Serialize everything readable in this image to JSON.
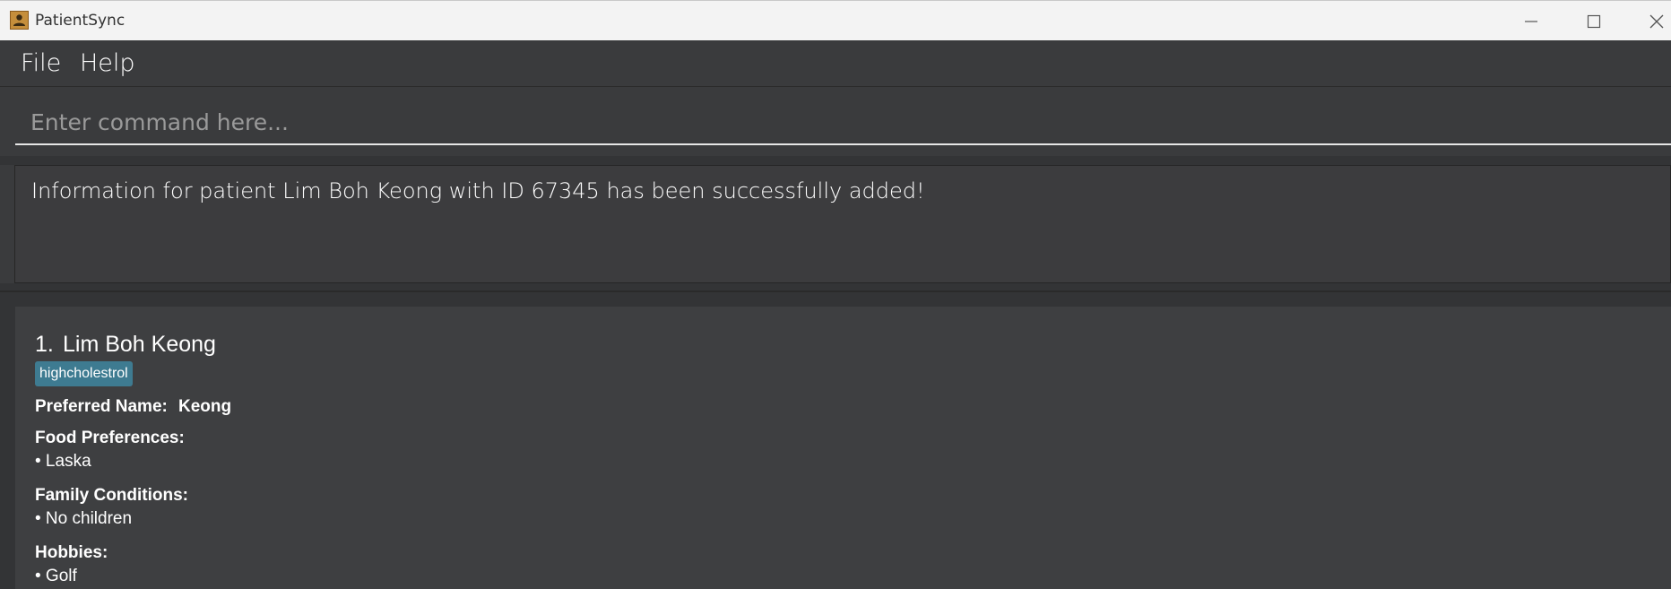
{
  "window": {
    "title": "PatientSync",
    "icon": "app-person-icon",
    "controls": [
      "minimize-icon",
      "maximize-icon",
      "close-icon"
    ]
  },
  "menu": {
    "items": [
      {
        "label": "File"
      },
      {
        "label": "Help"
      }
    ]
  },
  "command": {
    "value": "",
    "placeholder": "Enter command here..."
  },
  "result": {
    "message": "Information for patient Lim Boh Keong with ID 67345 has been successfully added!"
  },
  "patients": [
    {
      "index": "1.",
      "name": "Lim Boh Keong",
      "tags": [
        "highcholestrol"
      ],
      "preferred_name_label": "Preferred Name:",
      "preferred_name": "Keong",
      "food_label": "Food Preferences:",
      "food": [
        "• Laska"
      ],
      "family_label": "Family Conditions:",
      "family": [
        "• No children"
      ],
      "hobbies_label": "Hobbies:",
      "hobbies": [
        "• Golf"
      ]
    }
  ],
  "colors": {
    "background": "#3a3b3d",
    "card": "#3e3f41",
    "tag": "#3e7b91",
    "titlebar": "#f3f3f3"
  }
}
